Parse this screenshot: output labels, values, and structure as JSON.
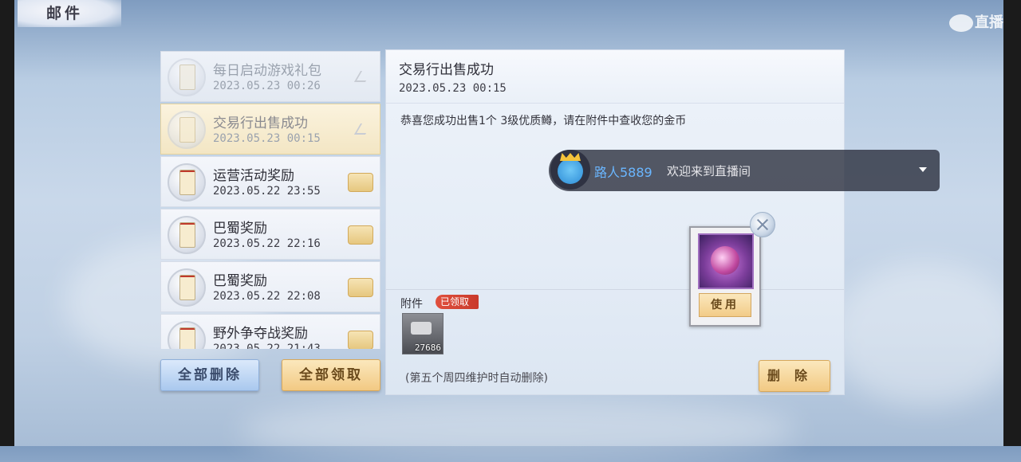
{
  "window": {
    "title": "邮件"
  },
  "watermark": {
    "text": "直播"
  },
  "mails": [
    {
      "subject": "每日启动游戏礼包",
      "time": "2023.05.23 00:26",
      "state": "read",
      "icon": "open-envelope-icon"
    },
    {
      "subject": "交易行出售成功",
      "time": "2023.05.23 00:15",
      "state": "read-selected",
      "icon": "open-envelope-icon"
    },
    {
      "subject": "运营活动奖励",
      "time": "2023.05.22 23:55",
      "state": "unread",
      "icon": "gift-box-icon"
    },
    {
      "subject": "巴蜀奖励",
      "time": "2023.05.22 22:16",
      "state": "unread",
      "icon": "gift-box-icon"
    },
    {
      "subject": "巴蜀奖励",
      "time": "2023.05.22 22:08",
      "state": "unread",
      "icon": "gift-box-icon"
    },
    {
      "subject": "野外争夺战奖励",
      "time": "2023.05.22 21:43",
      "state": "unread",
      "icon": "gift-box-icon"
    }
  ],
  "buttons": {
    "delete_all": "全部删除",
    "claim_all": "全部领取",
    "delete": "删除",
    "use": "使用"
  },
  "detail": {
    "title": "交易行出售成功",
    "time": "2023.05.23 00:15",
    "body": "恭喜您成功出售1个 3级优质鳟，请在附件中查收您的金币",
    "attachment_label": "附件",
    "attachment_status": "已领取",
    "attachment_count": "27686",
    "footnote": "(第五个周四维护时自动删除)"
  },
  "live_toast": {
    "user": "路人5889",
    "message": "欢迎来到直播间"
  },
  "colors": {
    "accent_blue": "#6ab6ff",
    "badge_red": "#d9453a",
    "gold": "#f2c983"
  }
}
